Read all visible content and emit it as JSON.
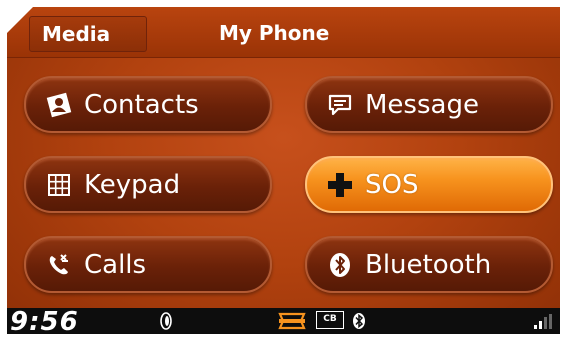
{
  "header": {
    "tab_label": "Media",
    "title": "My Phone"
  },
  "buttons": [
    {
      "label": "Contacts",
      "icon": "contacts-icon"
    },
    {
      "label": "Message",
      "icon": "message-icon"
    },
    {
      "label": "Keypad",
      "icon": "keypad-icon"
    },
    {
      "label": "SOS",
      "icon": "sos-cross-icon"
    },
    {
      "label": "Calls",
      "icon": "calls-icon"
    },
    {
      "label": "Bluetooth",
      "icon": "bluetooth-icon"
    }
  ],
  "status": {
    "clock": "9:56",
    "cb_label": "CB",
    "icons": [
      "tire-icon",
      "brand-logo-icon",
      "cb-radio-icon",
      "bluetooth-icon",
      "signal-strength-icon"
    ]
  },
  "colors": {
    "accent": "#f7931e",
    "background": "#b2420f",
    "button": "#6a2108"
  }
}
